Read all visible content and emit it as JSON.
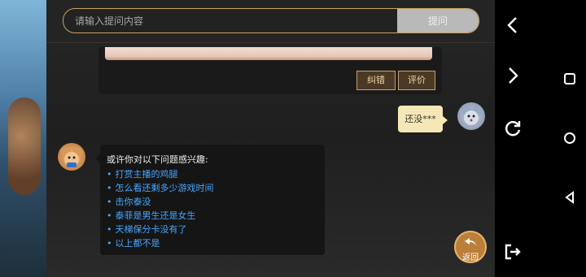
{
  "search": {
    "placeholder": "请输入提问内容",
    "submit_label": "提问"
  },
  "answer_card": {
    "actions": [
      "纠错",
      "评价"
    ]
  },
  "user_message": {
    "text": "还没***"
  },
  "bot_message": {
    "title": "或许你对以下问题感兴趣:",
    "suggestions": [
      "打赏主播的鸡腿",
      "怎么看还剩多少游戏时间",
      "击你泰没",
      "泰菲是男生还是女生",
      "天梯保分卡没有了",
      "以上都不是"
    ]
  },
  "back_button": {
    "label": "返回"
  },
  "colors": {
    "accent_gold": "#c9a45f",
    "link_blue": "#47a6ff",
    "user_bubble": "#f6e7b6",
    "back_button": "#bb7f3a"
  },
  "system_bar": {
    "icons": [
      "back-icon",
      "forward-icon",
      "refresh-icon",
      "exit-icon",
      "square-icon",
      "circle-icon",
      "triangle-icon"
    ]
  }
}
